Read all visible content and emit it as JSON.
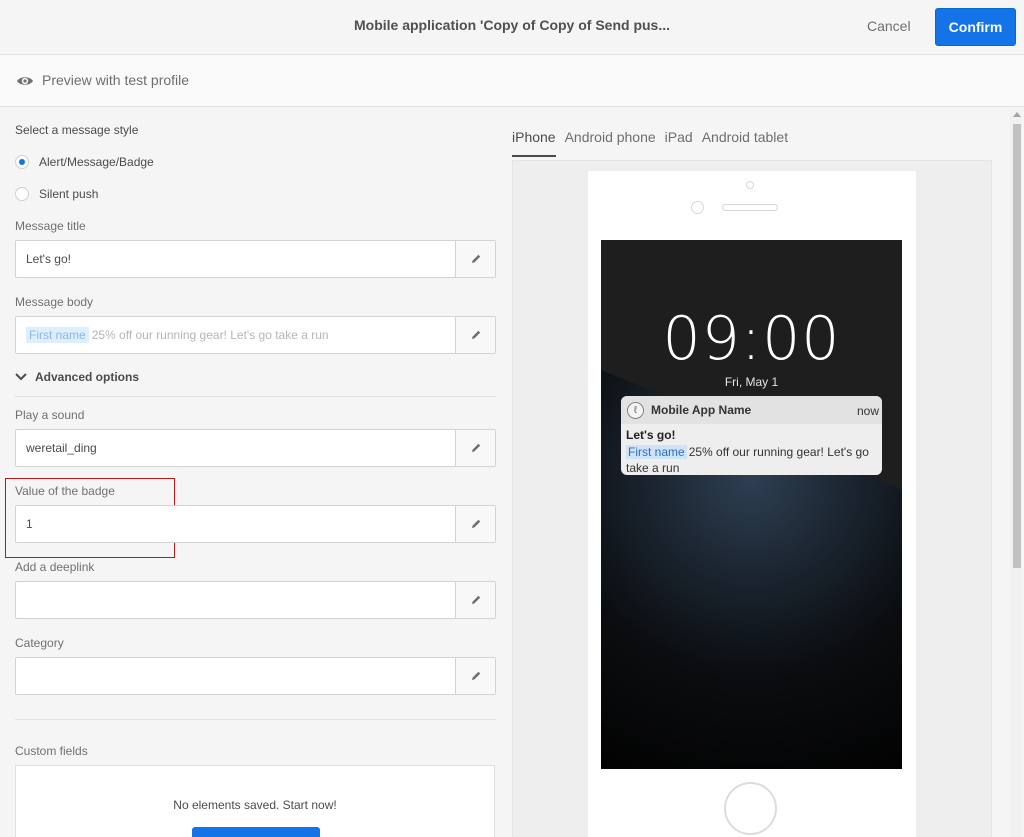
{
  "header": {
    "title": "Mobile application 'Copy of Copy of Send pus...",
    "cancel_label": "Cancel",
    "confirm_label": "Confirm"
  },
  "previewbar": {
    "label": "Preview with test profile",
    "icon": "eye-icon"
  },
  "form": {
    "style_label": "Select a message style",
    "style_options": [
      "Alert/Message/Badge",
      "Silent push"
    ],
    "style_selected": "Alert/Message/Badge",
    "message_title_label": "Message title",
    "message_title_value": "Let's go!",
    "message_body_label": "Message body",
    "message_body_chip": "First name",
    "message_body_value": "25% off our running gear! Let's go take a run",
    "advanced_label": "Advanced options",
    "sound_label": "Play a sound",
    "sound_value": "weretail_ding",
    "badge_label": "Value of the badge",
    "badge_value": "1",
    "deeplink_label": "Add a deeplink",
    "deeplink_value": "",
    "category_label": "Category",
    "category_value": "",
    "custom_fields_label": "Custom fields",
    "custom_fields_empty": "No elements saved. Start now!"
  },
  "preview": {
    "tabs": [
      "iPhone",
      "Android phone",
      "iPad",
      "Android tablet"
    ],
    "active_tab": "iPhone",
    "lock_time": "09:00",
    "lock_date": "Fri, May 1",
    "notification": {
      "app_name": "Mobile App Name",
      "time": "now",
      "title": "Let's go!",
      "body_chip": "First name",
      "body": "25% off our running gear! Let's go take a run"
    }
  },
  "colors": {
    "accent": "#1473e6",
    "highlight_border": "#b31b1b"
  }
}
